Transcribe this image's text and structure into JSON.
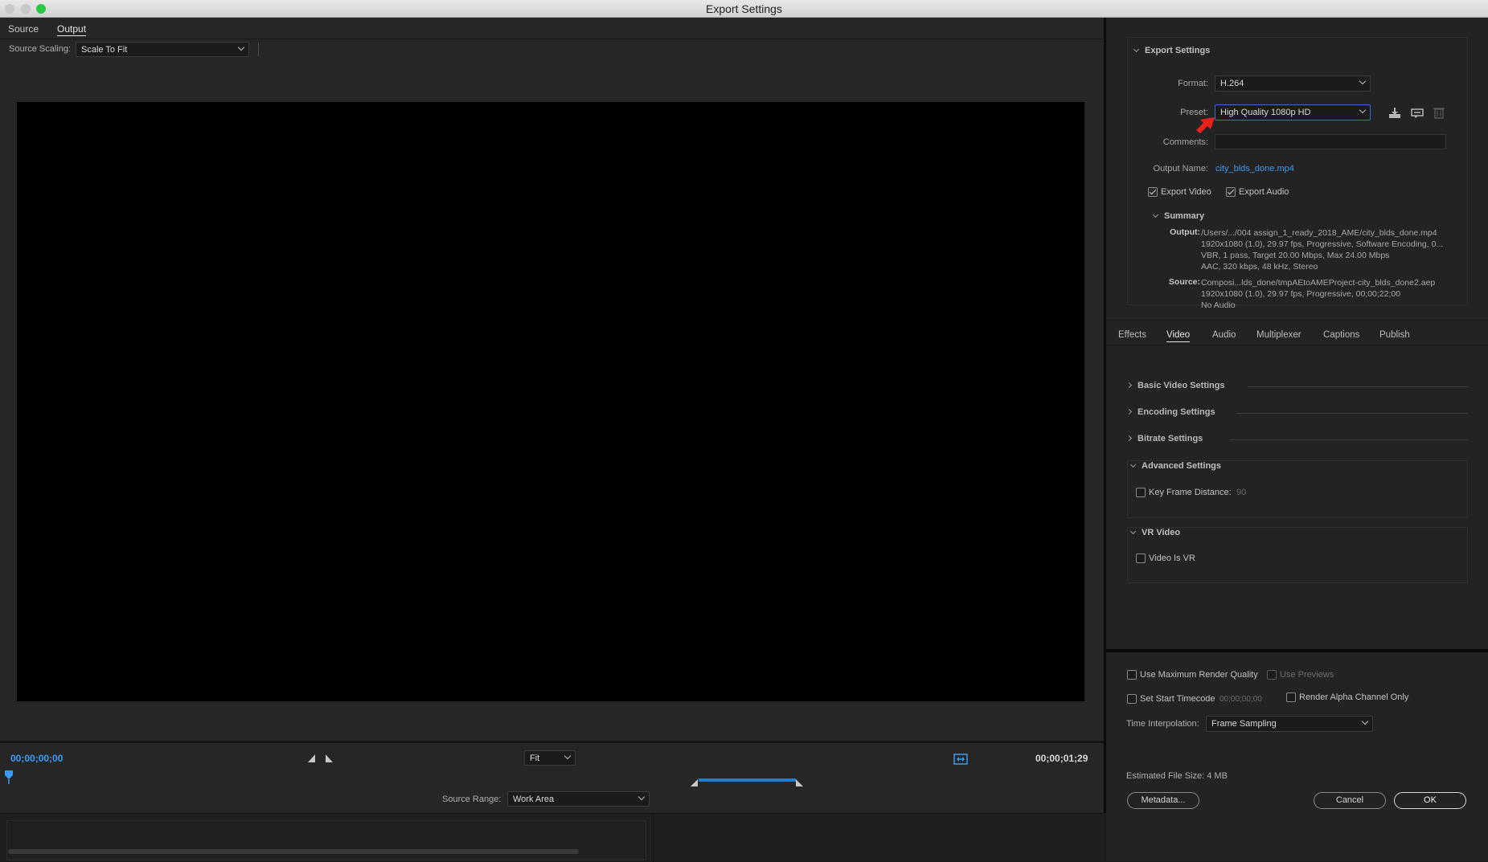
{
  "window": {
    "title": "Export Settings"
  },
  "tabs": {
    "source": "Source",
    "output": "Output"
  },
  "source_scaling": {
    "label": "Source Scaling:",
    "value": "Scale To Fit"
  },
  "timeline": {
    "current_tc": "00;00;00;00",
    "end_tc": "00;00;01;29",
    "zoom": "Fit",
    "source_range_label": "Source Range:",
    "source_range_value": "Work Area"
  },
  "export_settings": {
    "header": "Export Settings",
    "format_label": "Format:",
    "format_value": "H.264",
    "preset_label": "Preset:",
    "preset_value": "High Quality 1080p HD",
    "comments_label": "Comments:",
    "comments_value": "",
    "output_name_label": "Output Name:",
    "output_name_value": "city_blds_done.mp4",
    "export_video": "Export Video",
    "export_audio": "Export Audio",
    "summary_header": "Summary",
    "output_label": "Output:",
    "output_lines": [
      "/Users/.../004 assign_1_ready_2018_AME/city_blds_done.mp4",
      "1920x1080 (1.0), 29.97 fps, Progressive, Software Encoding, 0...",
      "VBR, 1 pass, Target 20.00 Mbps, Max 24.00 Mbps",
      "AAC, 320 kbps, 48 kHz, Stereo"
    ],
    "source_label": "Source:",
    "source_lines": [
      "Composi...lds_done/tmpAEtoAMEProject-city_blds_done2.aep",
      "1920x1080 (1.0), 29.97 fps, Progressive, 00;00;22;00",
      "No Audio"
    ]
  },
  "settings_tabs": [
    "Effects",
    "Video",
    "Audio",
    "Multiplexer",
    "Captions",
    "Publish"
  ],
  "video_sections": {
    "basic": "Basic Video Settings",
    "encoding": "Encoding Settings",
    "bitrate": "Bitrate Settings",
    "advanced": "Advanced Settings",
    "key_frame_label": "Key Frame Distance:",
    "key_frame_value": "90",
    "vr": "VR Video",
    "video_is_vr": "Video Is VR"
  },
  "bottom_options": {
    "max_render": "Use Maximum Render Quality",
    "use_previews": "Use Previews",
    "start_tc": "Set Start Timecode",
    "start_tc_value": "00;00;00;00",
    "alpha_only": "Render Alpha Channel Only",
    "time_interp_label": "Time Interpolation:",
    "time_interp_value": "Frame Sampling",
    "file_size": "Estimated File Size:  4 MB",
    "metadata": "Metadata...",
    "cancel": "Cancel",
    "ok": "OK"
  },
  "colors": {
    "accent": "#3b9bf5",
    "preset_highlight": "#2f6fd6",
    "annotation_arrow": "#e8201c"
  },
  "icons": [
    "save-preset-icon",
    "import-preset-icon",
    "delete-preset-icon",
    "mark-in-icon",
    "mark-out-icon",
    "fit-frame-icon",
    "playhead-icon"
  ]
}
